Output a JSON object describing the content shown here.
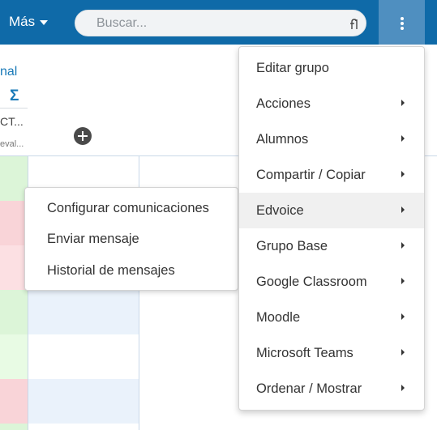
{
  "topbar": {
    "mas_label": "Más",
    "search_placeholder": "Buscar...",
    "accent": "#0f6aa8"
  },
  "grid": {
    "col_label": "nal",
    "sigma": "Σ",
    "col_code": "CT...",
    "col_sub": "eval...",
    "colors": {
      "green": "#dcf5d8",
      "red": "#f9d4d8",
      "blue": "#eaf2fb"
    }
  },
  "menu": {
    "items": [
      {
        "label": "Editar grupo",
        "has_submenu": false
      },
      {
        "label": "Acciones",
        "has_submenu": true
      },
      {
        "label": "Alumnos",
        "has_submenu": true
      },
      {
        "label": "Compartir / Copiar",
        "has_submenu": true
      },
      {
        "label": "Edvoice",
        "has_submenu": true,
        "active": true
      },
      {
        "label": "Grupo Base",
        "has_submenu": true
      },
      {
        "label": "Google Classroom",
        "has_submenu": true
      },
      {
        "label": "Moodle",
        "has_submenu": true
      },
      {
        "label": "Microsoft Teams",
        "has_submenu": true
      },
      {
        "label": "Ordenar / Mostrar",
        "has_submenu": true
      }
    ]
  },
  "submenu": {
    "items": [
      {
        "label": "Configurar comunicaciones"
      },
      {
        "label": "Enviar mensaje"
      },
      {
        "label": "Historial de mensajes"
      }
    ]
  }
}
